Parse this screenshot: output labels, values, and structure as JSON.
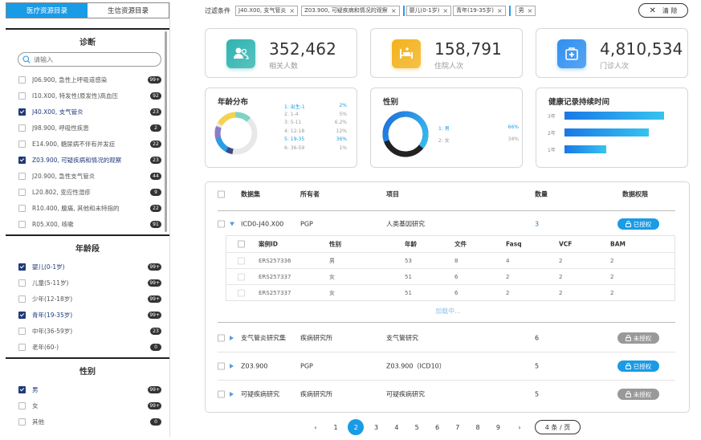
{
  "sidebar": {
    "tabs": [
      "医疗资源目录",
      "生信资源目录"
    ],
    "diagnosis": {
      "title": "诊断",
      "search_placeholder": "请输入",
      "items": [
        {
          "label": "J06.900, 急性上呼吸道感染",
          "count": "99+",
          "checked": false
        },
        {
          "label": "I10.X00, 特发性(原发性)高血压",
          "count": "92",
          "checked": false
        },
        {
          "label": "J40.X00, 支气管炎",
          "count": "23",
          "checked": true
        },
        {
          "label": "J98.900, 呼吸性疾患",
          "count": "2",
          "checked": false
        },
        {
          "label": "E14.900, 糖尿病不伴有并发症",
          "count": "22",
          "checked": false
        },
        {
          "label": "Z03.900, 可疑疾病和情况的观察",
          "count": "23",
          "checked": true
        },
        {
          "label": "J20.900, 急性支气管炎",
          "count": "44",
          "checked": false
        },
        {
          "label": "L20.802, 变应性湿疹",
          "count": "9",
          "checked": false
        },
        {
          "label": "R10.400, 腹痛, 其他和未特指的",
          "count": "22",
          "checked": false
        },
        {
          "label": "R05.X00, 咳嗽",
          "count": "91",
          "checked": false
        }
      ]
    },
    "age": {
      "title": "年龄段",
      "items": [
        {
          "label": "婴儿(0-1岁)",
          "count": "99+",
          "checked": true
        },
        {
          "label": "儿童(5-11岁)",
          "count": "99+",
          "checked": false
        },
        {
          "label": "少年(12-18岁)",
          "count": "99+",
          "checked": false
        },
        {
          "label": "青年(19-35岁)",
          "count": "99+",
          "checked": true
        },
        {
          "label": "中年(36-59岁)",
          "count": "23",
          "checked": false
        },
        {
          "label": "老年(60-)",
          "count": "0",
          "checked": false
        }
      ]
    },
    "gender": {
      "title": "性别",
      "items": [
        {
          "label": "男",
          "count": "99+",
          "checked": true
        },
        {
          "label": "女",
          "count": "99+",
          "checked": false
        },
        {
          "label": "其他",
          "count": "0",
          "checked": false
        }
      ]
    }
  },
  "filters": {
    "label": "过滤条件",
    "tags": [
      "J40.X00, 支气管炎",
      "Z03.900, 可疑疾病和情况的观察"
    ],
    "group_tags": [
      "婴儿(0-1岁)",
      "青年(19-35岁)"
    ],
    "tail_tags": [
      "男"
    ],
    "clear_label": "清 除"
  },
  "stats": [
    {
      "value": "352,462",
      "label": "相关人数",
      "icon": "users-icon",
      "color": "#2fb3b0"
    },
    {
      "value": "158,791",
      "label": "住院人次",
      "icon": "bed-icon",
      "color": "#f3b21c"
    },
    {
      "value": "4,810,534",
      "label": "门诊人次",
      "icon": "clinic-icon",
      "color": "#2f8ff0"
    }
  ],
  "charts": {
    "age": {
      "title": "年龄分布",
      "legend": [
        {
          "label": "1: 出生-1",
          "value": "2%",
          "hl": true
        },
        {
          "label": "2: 1-4",
          "value": "5%",
          "hl": false
        },
        {
          "label": "3: 5-11",
          "value": "6.2%",
          "hl": false
        },
        {
          "label": "4: 12-18",
          "value": "12%",
          "hl": false
        },
        {
          "label": "5: 19-35",
          "value": "36%",
          "hl": true
        },
        {
          "label": "6: 36-59",
          "value": "1%",
          "hl": false
        }
      ]
    },
    "gender": {
      "title": "性别",
      "legend": [
        {
          "label": "1: 男",
          "value": "66%",
          "hl": true
        },
        {
          "label": "2: 女",
          "value": "34%",
          "hl": false
        }
      ]
    },
    "health": {
      "title": "健康记录持续时间",
      "bars": [
        {
          "label": "3年",
          "value": 0.98
        },
        {
          "label": "2年",
          "value": 0.83
        },
        {
          "label": "1年",
          "value": 0.41
        }
      ]
    }
  },
  "table": {
    "headers": [
      "数据集",
      "所有者",
      "项目",
      "数量",
      "数据权限"
    ],
    "rows": [
      {
        "dataset": "ICD0-J40.X00",
        "owner": "PGP",
        "project": "人类基因研究",
        "count": "3",
        "perm": "已授权",
        "granted": true,
        "expanded": true
      },
      {
        "dataset": "支气管炎研究集",
        "owner": "疾病研究所",
        "project": "支气管研究",
        "count": "6",
        "perm": "未授权",
        "granted": false,
        "expanded": false
      },
      {
        "dataset": "Z03.900",
        "owner": "PGP",
        "project": "Z03.900（ICD10）",
        "count": "5",
        "perm": "已授权",
        "granted": true,
        "expanded": false
      },
      {
        "dataset": "可疑疾病研究",
        "owner": "疾病研究所",
        "project": "可疑疾病研究",
        "count": "5",
        "perm": "未授权",
        "granted": false,
        "expanded": false
      }
    ],
    "sub": {
      "headers": [
        "案例ID",
        "性别",
        "年龄",
        "文件",
        "Fasq",
        "VCF",
        "BAM"
      ],
      "rows": [
        [
          "ERS257336",
          "男",
          "53",
          "8",
          "4",
          "2",
          "2"
        ],
        [
          "ERS257337",
          "女",
          "51",
          "6",
          "2",
          "2",
          "2"
        ],
        [
          "ERS257337",
          "女",
          "51",
          "6",
          "2",
          "2",
          "2"
        ]
      ]
    },
    "loading": "加载中..."
  },
  "pagination": {
    "prev": "‹",
    "next": "›",
    "pages": [
      "1",
      "2",
      "3",
      "4",
      "5",
      "6",
      "7",
      "8",
      "9"
    ],
    "current": "2",
    "size_label": "4 条 / 页"
  }
}
